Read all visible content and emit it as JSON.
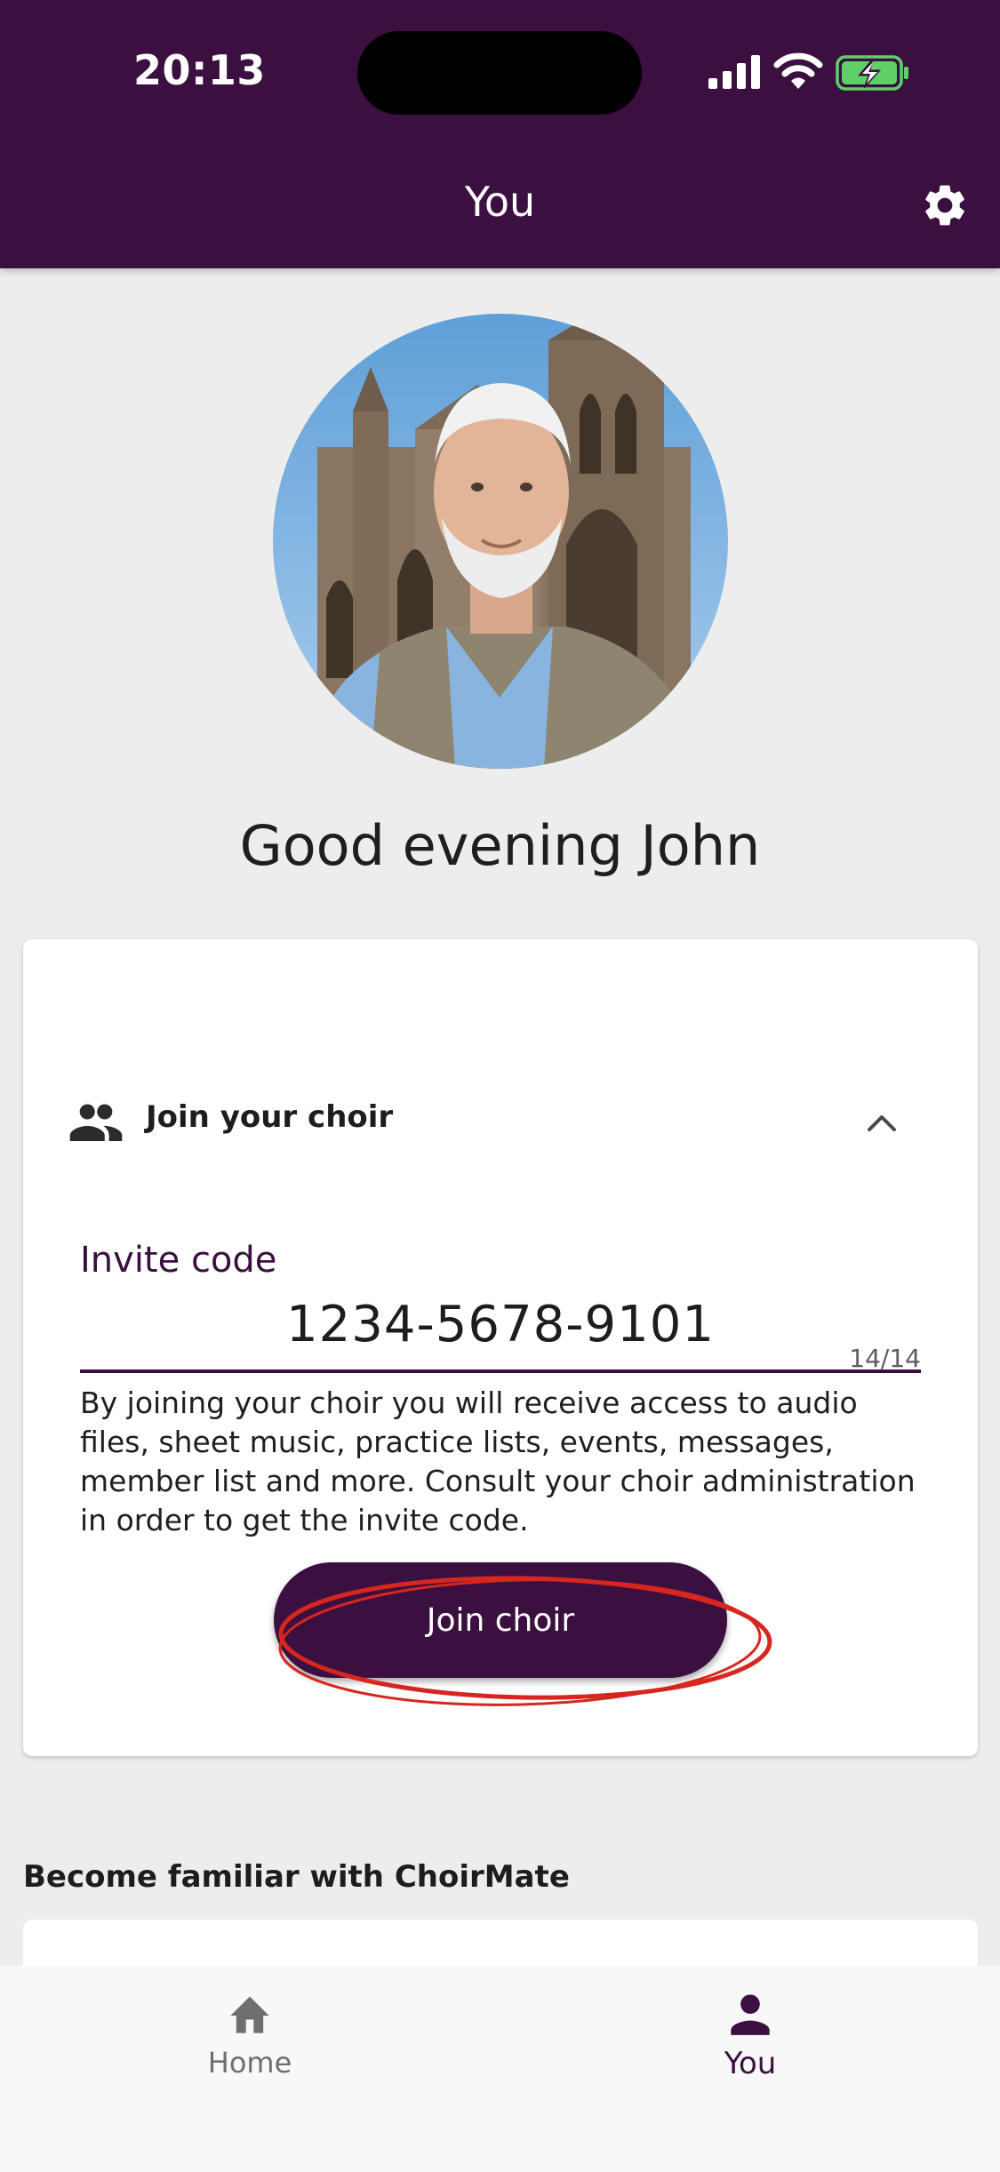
{
  "status_bar": {
    "time": "20:13",
    "icons": [
      "signal-icon",
      "wifi-icon",
      "battery-charging-icon"
    ]
  },
  "header": {
    "title": "You",
    "settings_icon": "gear-icon"
  },
  "profile": {
    "greeting": "Good evening John",
    "avatar_icon": "profile-photo"
  },
  "join_card": {
    "title": "Join your choir",
    "icon": "people-icon",
    "toggle_icon": "chevron-up-icon",
    "invite_label": "Invite code",
    "invite_value": "1234-5678-9101",
    "char_counter": "14/14",
    "description": "By joining your choir you will receive access to audio files, sheet music, practice lists, events, messages, member list and more. Consult your choir administration in order to get the invite code.",
    "join_button": "Join choir"
  },
  "familiar": {
    "heading": "Become familiar with ChoirMate"
  },
  "bottom_nav": {
    "items": [
      {
        "label": "Home",
        "icon": "home-icon",
        "active": false
      },
      {
        "label": "You",
        "icon": "person-icon",
        "active": true
      }
    ]
  },
  "colors": {
    "primary": "#3b1040",
    "background": "#ededed",
    "annotation": "#d7261e"
  }
}
